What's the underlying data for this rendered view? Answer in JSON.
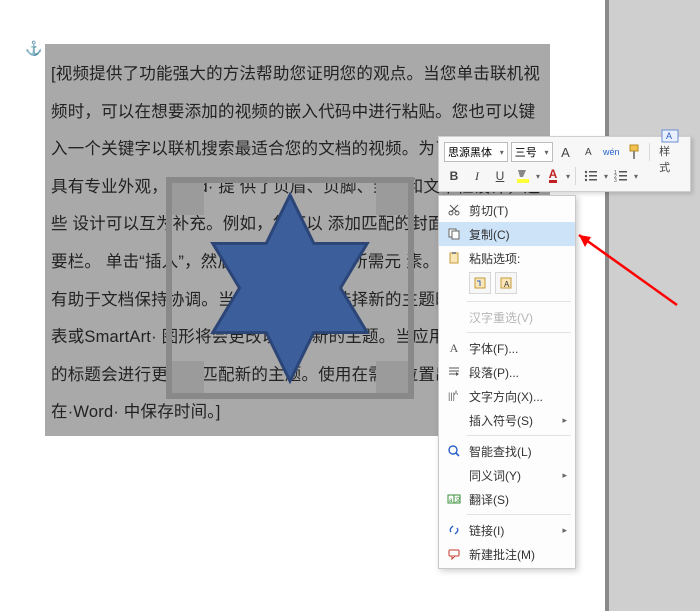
{
  "anchor_glyph": "⚓",
  "body_text": "[视频提供了功能强大的方法帮助您证明您的观点。当您单击联机视频时，可以在想要添加的视频的嵌入代码中进行粘贴。您也可以键入一个关键字以联机搜索最适合您的文档的视频。为了使您的文档具有专业外观，Word· 提                 供了页眉、页脚、封面和文本框设计，这些                                         设计可以互为补充。例如，您可以                                         添加匹配的封面、页眉和提要栏。                                         单击“插入”，然后从不同库中选择所需元                 素。主题和样式也有助于文档保持协调。当您单击设计并选择新的主题时，图片、图表或SmartArt· 图形将会更改以匹配新的主题。当应用样式时，您的标题会进行更改以匹配新的主题。使用在需要位置出现的新按钮在·Word· 中保存时间。]",
  "toolbar": {
    "font_name": "思源黑体",
    "font_size": "三号",
    "inc_label": "A",
    "dec_label": "A",
    "wen_label": "wén",
    "brush_title": "格式刷",
    "bold": "B",
    "italic": "I",
    "underline": "U",
    "font_color": "A",
    "styles_label": "样式"
  },
  "menu": {
    "cut": "剪切(T)",
    "copy": "复制(C)",
    "paste_header": "粘贴选项:",
    "hanzi": "汉字重选(V)",
    "font": "字体(F)...",
    "para": "段落(P)...",
    "textdir": "文字方向(X)...",
    "symbol": "插入符号(S)",
    "smart": "智能查找(L)",
    "synonym": "同义词(Y)",
    "translate": "翻译(S)",
    "link": "链接(I)",
    "comment": "新建批注(M)"
  },
  "colors": {
    "star_fill": "#3c5e9b",
    "star_stroke": "#2b4577",
    "highlight": "#cde3f8",
    "arrow": "#ff0000"
  }
}
